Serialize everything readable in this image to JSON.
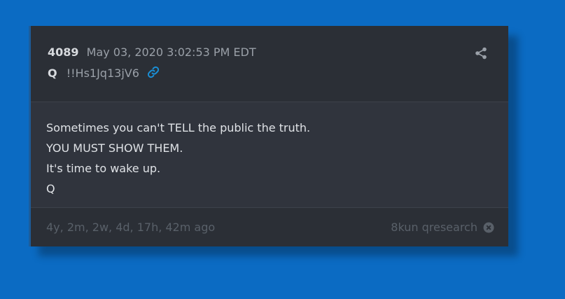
{
  "post": {
    "number": "4089",
    "datetime": "May 03, 2020 3:02:53 PM EDT",
    "author": "Q",
    "tripcode": "!!Hs1Jq13jV6",
    "lines": [
      "Sometimes you can't TELL the public the truth.",
      "YOU MUST SHOW THEM.",
      "It's time to wake up.",
      "Q"
    ],
    "age": "4y, 2m, 2w, 4d, 17h, 42m ago",
    "source": "8kun qresearch"
  },
  "colors": {
    "background": "#0b6bc3",
    "link_icon": "#1a8fd6"
  },
  "icons": {
    "share": "share-icon",
    "link": "link-icon",
    "close": "close-circle-icon"
  }
}
